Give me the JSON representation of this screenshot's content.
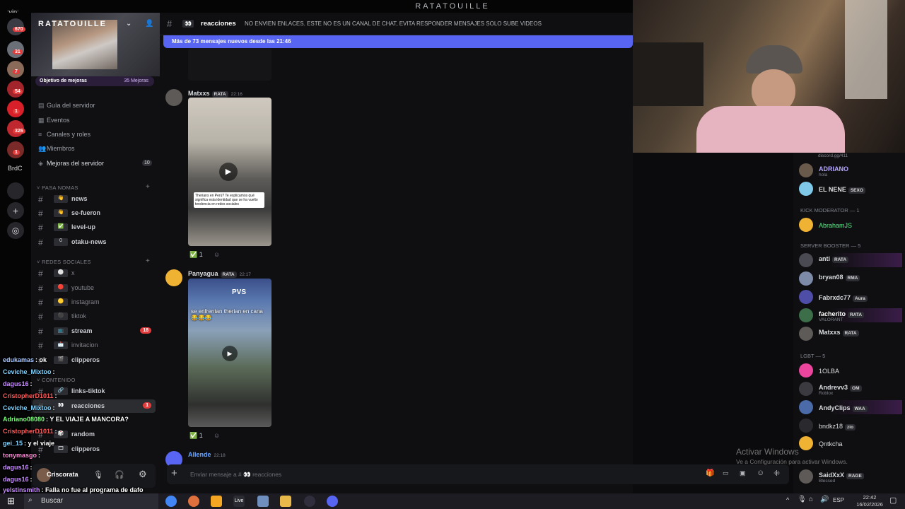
{
  "top": {
    "title": "RATATOUILLE",
    "vip": ":vip:"
  },
  "rail": {
    "badges": [
      "670",
      "31",
      "7",
      "54",
      "1",
      "326",
      "1"
    ],
    "label": "BrdC"
  },
  "server": {
    "name": "RATATOUILLE",
    "boost_goal": "Objetivo de mejoras",
    "boost_count": "35 Mejoras",
    "menu": [
      "Guía del servidor",
      "Eventos",
      "Canales y roles",
      "Miembros",
      "Mejoras del servidor"
    ],
    "menu_badge": "10",
    "categories": [
      "PASA NOMAS",
      "REDES SOCIALES",
      "CONTENIDO"
    ],
    "channels": [
      {
        "emoji": "👋",
        "name": "news"
      },
      {
        "emoji": "👋",
        "name": "se-fueron"
      },
      {
        "emoji": "✅",
        "name": "level-up"
      },
      {
        "emoji": "0",
        "name": "otaku-news"
      },
      {
        "emoji": "⚪",
        "name": "x"
      },
      {
        "emoji": "🔴",
        "name": "youtube"
      },
      {
        "emoji": "🟡",
        "name": "instagram"
      },
      {
        "emoji": "⚫",
        "name": "tiktok"
      },
      {
        "emoji": "📺",
        "name": "stream",
        "badge": "18"
      },
      {
        "emoji": "📩",
        "name": "invitacion"
      },
      {
        "emoji": "🎬",
        "name": "clipperos"
      },
      {
        "emoji": "🔗",
        "name": "links-tiktok"
      },
      {
        "emoji": "👀",
        "name": "reacciones",
        "badge": "1"
      },
      {
        "emoji": "🎲",
        "name": "random"
      },
      {
        "emoji": "🎞",
        "name": "clipperos"
      }
    ]
  },
  "stream_chat": [
    {
      "user": "edukamas",
      "color": "#a8c7ff",
      "text": ": ok"
    },
    {
      "user": "Ceviche_Mixtoo",
      "color": "#7fd3ff",
      "text": ":"
    },
    {
      "user": "dagus16",
      "color": "#c78cff",
      "text": ":"
    },
    {
      "user": "CristopherD1011",
      "color": "#ff5a5a",
      "text": ":"
    },
    {
      "user": "Ceviche_Mixtoo",
      "color": "#7fd3ff",
      "text": ":"
    },
    {
      "user": "Adriano08080",
      "color": "#7cff7c",
      "text": ": Y EL VIAJE A MANCORA?"
    },
    {
      "user": "CristopherD1011",
      "color": "#ff5a5a",
      "text": ":"
    },
    {
      "user": "gei_15",
      "color": "#7fd3ff",
      "text": ": y el viaje"
    },
    {
      "user": "tonymasgo",
      "color": "#ff8ad8",
      "text": ":"
    },
    {
      "user": "dagus16",
      "color": "#c78cff",
      "text": ":"
    },
    {
      "user": "dagus16",
      "color": "#c78cff",
      "text": ":"
    },
    {
      "user": "yelstinsmith",
      "color": "#c78cff",
      "text": ": Falla no fue al programa de dafo"
    }
  ],
  "userpanel": {
    "name": "Criscorata"
  },
  "channel": {
    "name": "reacciones",
    "emoji": "👀",
    "topic": "NO ENVIEN ENLACES. ESTE NO ES UN CANAL DE CHAT, EVITA RESPONDER MENSAJES SOLO SUBE VIDEOS",
    "new_messages": "Más de 73 mensajes nuevos desde las 21:46"
  },
  "messages": [
    {
      "user": "Matxxs",
      "role": "RATA",
      "time": "22:16",
      "color": "#c8cbd0",
      "caption": "Therians en Perú? Te explicamos qué significa esta identidad que se ha vuelto tendencia en redes sociales",
      "reaction": "✅",
      "count": "1"
    },
    {
      "user": "Panyagua",
      "role": "RATA",
      "time": "22:17",
      "color": "#c8cbd0",
      "caption": "se enfrentan therian en cana 😂😂😂",
      "sign": "PVS",
      "reaction": "✅",
      "count": "1"
    },
    {
      "user": "Allende",
      "role": "",
      "time": "22:18",
      "color": "#6aa5ff"
    }
  ],
  "input": {
    "placeholder": "Enviar mensaje a # 👀 reacciones"
  },
  "members": {
    "top_text": "discord.gg/411",
    "groups": [
      {
        "title": "",
        "items": [
          {
            "name": "ADRIANO",
            "sub": "hola",
            "color": "#b6a6ff"
          },
          {
            "name": "EL NENE",
            "role": "SEXO",
            "color": "#e0e0e0"
          }
        ]
      },
      {
        "title": "KICK MODERATOR — 1",
        "items": [
          {
            "name": "AbrahamJS",
            "color": "#57f287"
          }
        ]
      },
      {
        "title": "SERVER BOOSTER — 5",
        "items": [
          {
            "name": "anti",
            "role": "RATA",
            "color": "#dbdee1"
          },
          {
            "name": "bryan08",
            "role": "RMA",
            "color": "#dbdee1"
          },
          {
            "name": "Fabrxdc77",
            "role": "Aura",
            "color": "#dbdee1"
          },
          {
            "name": "facherito",
            "role": "RATA",
            "sub": "VALORANT",
            "color": "#ffffff"
          },
          {
            "name": "Matxxs",
            "role": "RATA",
            "color": "#dbdee1"
          }
        ]
      },
      {
        "title": "LGBT — 5",
        "items": [
          {
            "name": "1OLBA",
            "color": "#dbdee1"
          },
          {
            "name": "Andrevv3",
            "role": "OM",
            "sub": "Roblox",
            "color": "#dbdee1"
          },
          {
            "name": "AndyClips",
            "role": "WAA",
            "color": "#dbdee1"
          },
          {
            "name": "bndkz18",
            "role": "zio",
            "color": "#dbdee1"
          },
          {
            "name": "Qntkcha",
            "color": "#dbdee1"
          },
          {
            "name": "SaidXxX",
            "role": "RAGE",
            "sub": "Blessed",
            "color": "#dbdee1"
          }
        ]
      }
    ]
  },
  "watermark": {
    "line1": "Activar Windows",
    "line2": "Ve a Configuración para activar Windows."
  },
  "taskbar": {
    "search": "Buscar",
    "lang": "ESP",
    "time": "22:42",
    "date": "16/02/2026"
  }
}
